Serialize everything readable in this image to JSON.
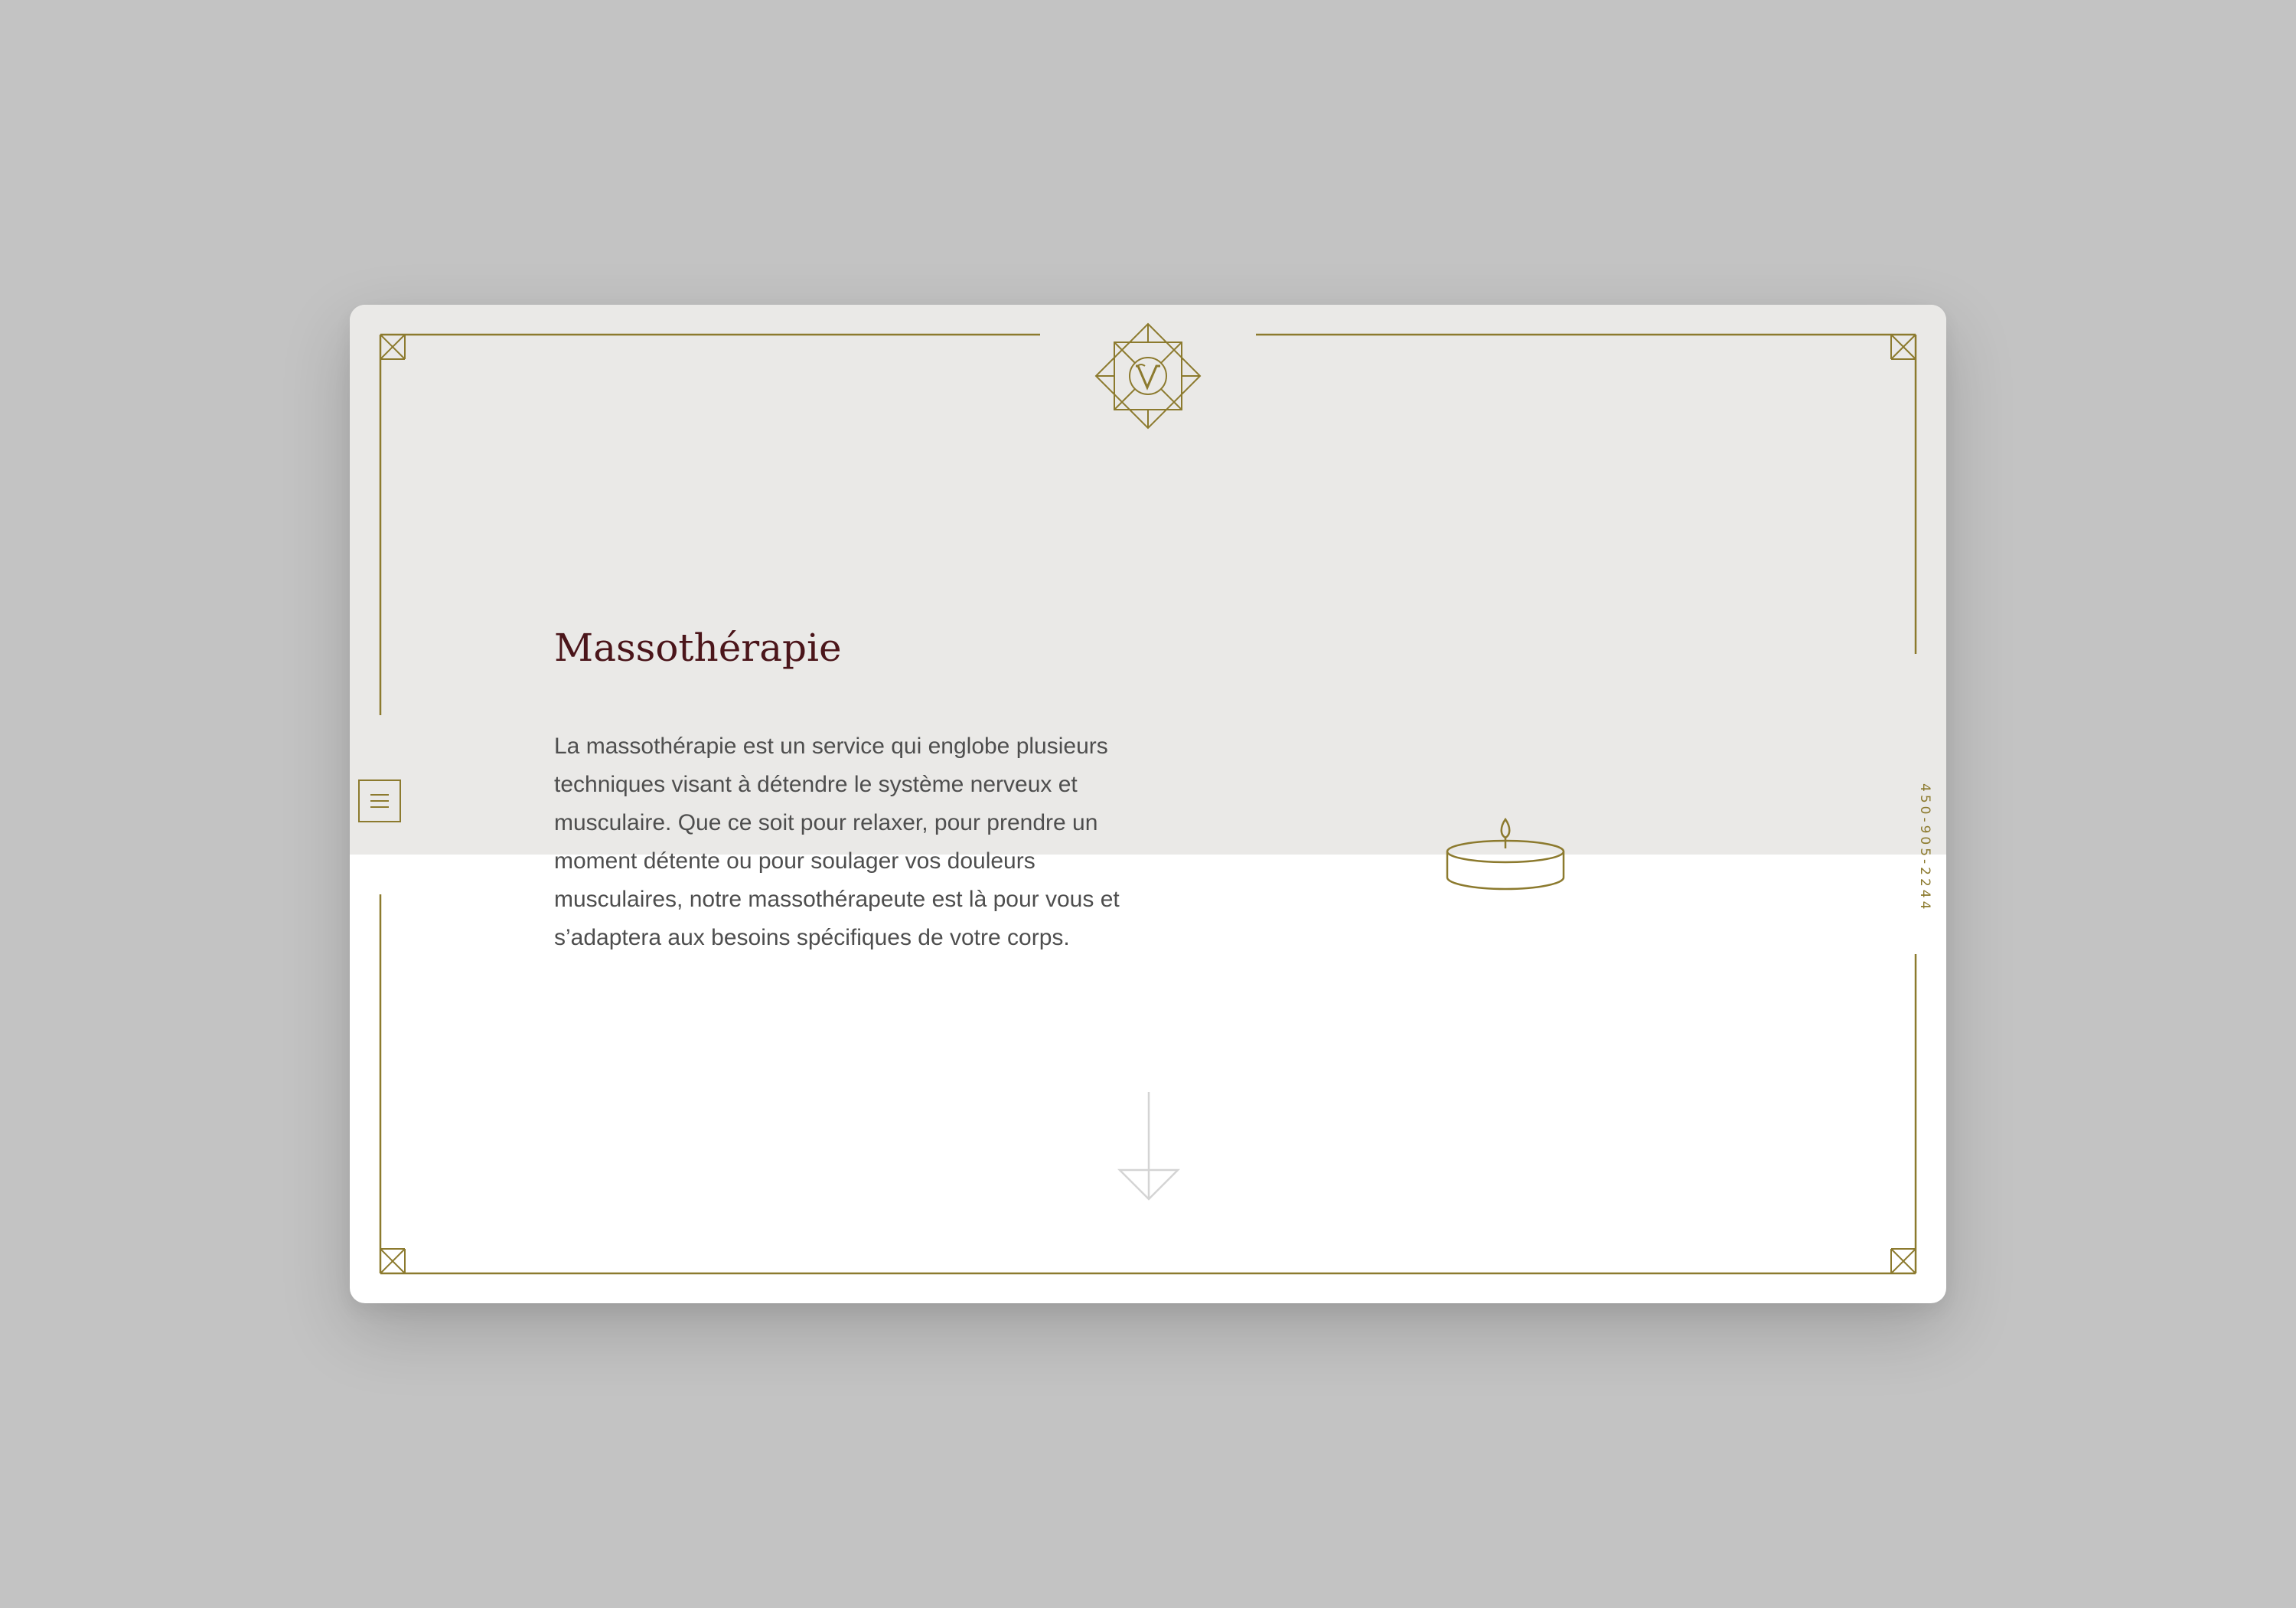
{
  "brand": {
    "logo_icon": "v-monogram-star-icon"
  },
  "navigation": {
    "menu_icon": "hamburger-menu-icon"
  },
  "contact": {
    "phone": "450-905-2244"
  },
  "content": {
    "title": "Massothérapie",
    "description": "La massothérapie est un service qui englobe plusieurs techniques visant à détendre le système nerveux et musculaire. Que ce soit pour relaxer, pour prendre un moment détente ou pour soulager vos douleurs musculaires, notre massothérapeute est là pour vous et s’adaptera aux besoins spécifiques de votre corps."
  },
  "decor": {
    "candle_icon": "candle-icon",
    "scroll_icon": "arrow-down-icon"
  },
  "colors": {
    "background": "#c3c3c3",
    "card_top": "#eae9e7",
    "card_bottom": "#ffffff",
    "accent_gold": "#8c7a2e",
    "heading": "#4b151a",
    "body_text": "#4e4e4e"
  }
}
